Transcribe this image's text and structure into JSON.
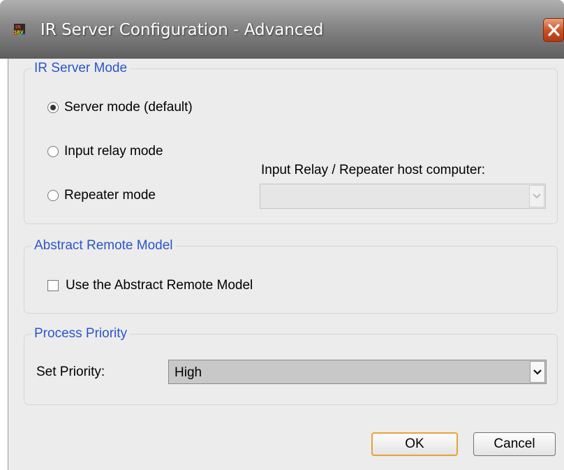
{
  "window": {
    "title": "IR Server Configuration - Advanced",
    "app_icon": "ir-server-icon",
    "close_icon": "close-icon"
  },
  "server_mode": {
    "legend": "IR Server Mode",
    "options": [
      {
        "label": "Server mode (default)",
        "checked": true
      },
      {
        "label": "Input relay mode",
        "checked": false
      },
      {
        "label": "Repeater mode",
        "checked": false
      }
    ],
    "host_label": "Input Relay / Repeater host computer:",
    "host_value": ""
  },
  "abstract_model": {
    "legend": "Abstract Remote Model",
    "checkbox_label": "Use the Abstract Remote Model",
    "checked": false
  },
  "process_priority": {
    "legend": "Process Priority",
    "set_label": "Set Priority:",
    "selected": "High"
  },
  "buttons": {
    "ok": "OK",
    "cancel": "Cancel"
  },
  "colors": {
    "legend_text": "#2b56c9",
    "close_button": "#c94f22",
    "default_button_border": "#e8a23a"
  }
}
